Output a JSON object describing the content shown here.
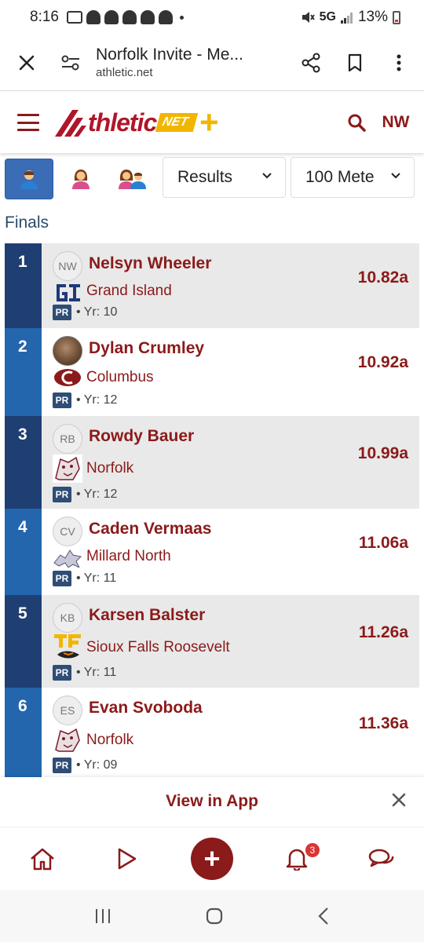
{
  "status": {
    "time": "8:16",
    "network": "5G",
    "battery": "13%"
  },
  "browser": {
    "title": "Norfolk Invite - Me...",
    "url": "athletic.net"
  },
  "header": {
    "logo_word": "thletic",
    "logo_net": "NET",
    "user_initials": "NW"
  },
  "filters": {
    "view_select": "Results",
    "event_select": "100 Mete",
    "gender_tabs": [
      "male",
      "female",
      "both"
    ]
  },
  "section_label": "Finals",
  "results": [
    {
      "place": "1",
      "name": "Nelsyn Wheeler",
      "initials": "NW",
      "team": "Grand Island",
      "pr": "PR",
      "year": "• Yr: 10",
      "mark": "10.82a"
    },
    {
      "place": "2",
      "name": "Dylan Crumley",
      "initials": "",
      "team": "Columbus",
      "pr": "PR",
      "year": "• Yr: 12",
      "mark": "10.92a"
    },
    {
      "place": "3",
      "name": "Rowdy Bauer",
      "initials": "RB",
      "team": "Norfolk",
      "pr": "PR",
      "year": "• Yr: 12",
      "mark": "10.99a"
    },
    {
      "place": "4",
      "name": "Caden Vermaas",
      "initials": "CV",
      "team": "Millard North",
      "pr": "PR",
      "year": "• Yr: 11",
      "mark": "11.06a"
    },
    {
      "place": "5",
      "name": "Karsen Balster",
      "initials": "KB",
      "team": "Sioux Falls Roosevelt",
      "pr": "PR",
      "year": "• Yr: 11",
      "mark": "11.26a"
    },
    {
      "place": "6",
      "name": "Evan Svoboda",
      "initials": "ES",
      "team": "Norfolk",
      "pr": "PR",
      "year": "• Yr: 09",
      "mark": "11.36a"
    }
  ],
  "view_in_app": "View in App",
  "bottom_nav": {
    "notification_count": "3"
  },
  "colors": {
    "maroon": "#8b1a1a",
    "navy": "#1f3f73",
    "blue": "#2366ae",
    "gold": "#f2b600"
  }
}
